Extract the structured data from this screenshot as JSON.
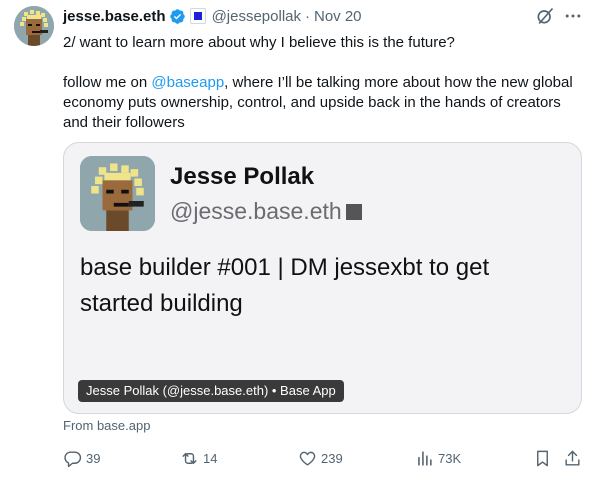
{
  "tweet": {
    "author_name": "jesse.base.eth",
    "handle": "@jessepollak",
    "separator": "·",
    "time": "Nov 20",
    "line1": "2/ want to learn more about why I believe this is the future?",
    "line2_prefix": "follow me on ",
    "line2_mention": "@baseapp",
    "line2_suffix": ", where I’ll be talking more about how the new global economy puts ownership, control, and upside back in the hands of creators and their followers"
  },
  "card": {
    "name": "Jesse Pollak",
    "handle": "@jesse.base.eth",
    "bio": "base builder #001 | DM jessexbt to get started building",
    "label": "Jesse Pollak (@jesse.base.eth) • Base App"
  },
  "source": "From base.app",
  "actions": {
    "replies": "39",
    "reposts": "14",
    "likes": "239",
    "views": "73K"
  },
  "colors": {
    "accent": "#1d9bf0",
    "text": "#0f1419",
    "muted": "#536471",
    "card_bg": "#f3f3f5",
    "badge": "#1d22d6"
  },
  "icons": {
    "verified": "verified-badge-icon",
    "affiliate": "square-affiliate-icon",
    "grok": "grok-icon",
    "more": "more-icon",
    "reply": "reply-icon",
    "repost": "repost-icon",
    "like": "heart-icon",
    "views": "views-icon",
    "bookmark": "bookmark-icon",
    "share": "share-icon"
  }
}
